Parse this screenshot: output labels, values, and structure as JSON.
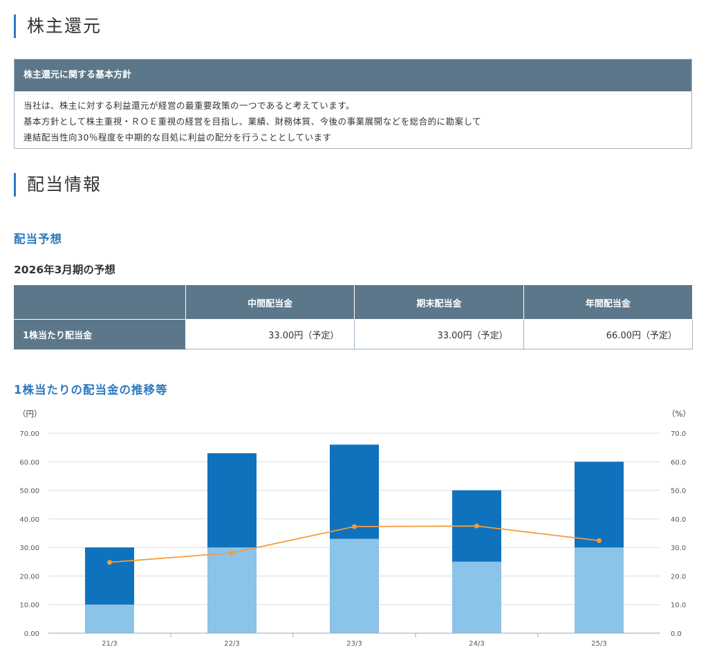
{
  "sections": {
    "return_title": "株主還元",
    "dividend_info_title": "配当情報"
  },
  "policy": {
    "heading": "株主還元に関する基本方針",
    "lines": [
      "当社は、株主に対する利益還元が経営の最重要政策の一つであると考えています。",
      "基本方針として株主重視・ＲＯＥ重視の経営を目指し、業績、財務体質、今後の事業展開などを総合的に勘案して",
      "連結配当性向30％程度を中期的な目処に利益の配分を行うこととしています"
    ]
  },
  "forecast": {
    "title": "配当予想",
    "period": "2026年3月期の予想",
    "columns": [
      "中間配当金",
      "期末配当金",
      "年間配当金"
    ],
    "row_label": "1株当たり配当金",
    "values": [
      "33.00円（予定）",
      "33.00円（予定）",
      "66.00円（予定）"
    ]
  },
  "chart_section_title": "1株当たりの配当金の推移等",
  "chart_data": {
    "type": "bar",
    "stacked": true,
    "left_unit": "（円）",
    "right_unit": "（%）",
    "categories": [
      "21/3",
      "22/3",
      "23/3",
      "24/3",
      "25/3"
    ],
    "left_ticks": [
      "0.00",
      "10.00",
      "20.00",
      "30.00",
      "40.00",
      "50.00",
      "60.00",
      "70.00"
    ],
    "right_ticks": [
      "0.0",
      "10.0",
      "20.0",
      "30.0",
      "40.0",
      "50.0",
      "60.0",
      "70.0"
    ],
    "ylim": [
      0,
      70
    ],
    "grid": true,
    "series": [
      {
        "values": [
          10,
          30,
          33,
          25,
          30
        ],
        "color": "#8cc3e8",
        "type": "bar"
      },
      {
        "values": [
          20,
          33,
          33,
          25,
          30
        ],
        "color": "#0f72bd",
        "type": "bar"
      },
      {
        "values": [
          24.8,
          28.1,
          37.3,
          37.5,
          32.4
        ],
        "color": "#f39c3c",
        "type": "line",
        "axis": "right"
      }
    ]
  }
}
